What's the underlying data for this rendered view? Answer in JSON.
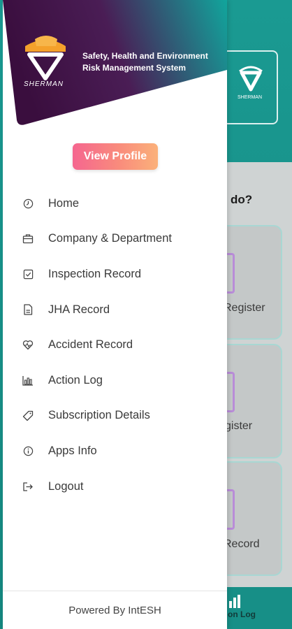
{
  "colors": {
    "header_gradient_start": "#3a0e3e",
    "header_gradient_end": "#11a59c",
    "button_gradient_start": "#f5668f",
    "button_gradient_end": "#fbb17a",
    "brand_orange": "#f4a12b"
  },
  "header": {
    "brand_word": "SHERMAN",
    "title_line1": "Safety, Health and Environment",
    "title_line2": "Risk Management System"
  },
  "profile": {
    "view_profile_label": "View Profile"
  },
  "menu": {
    "items": [
      {
        "label": "Home",
        "icon": "clock-icon"
      },
      {
        "label": "Company & Department",
        "icon": "briefcase-icon"
      },
      {
        "label": "Inspection Record",
        "icon": "checkbox-icon"
      },
      {
        "label": "JHA Record",
        "icon": "document-icon"
      },
      {
        "label": "Accident Record",
        "icon": "heartbeat-icon"
      },
      {
        "label": "Action Log",
        "icon": "bar-chart-icon"
      },
      {
        "label": "Subscription Details",
        "icon": "tag-icon"
      },
      {
        "label": "Apps Info",
        "icon": "info-icon"
      },
      {
        "label": "Logout",
        "icon": "logout-icon"
      }
    ]
  },
  "footer": {
    "powered_by": "Powered By IntESH"
  },
  "background": {
    "question_fragment": "do?",
    "cards": [
      {
        "label": "Register"
      },
      {
        "label": "gister"
      },
      {
        "label": "Record"
      }
    ],
    "bottom_nav_label": "on Log"
  }
}
